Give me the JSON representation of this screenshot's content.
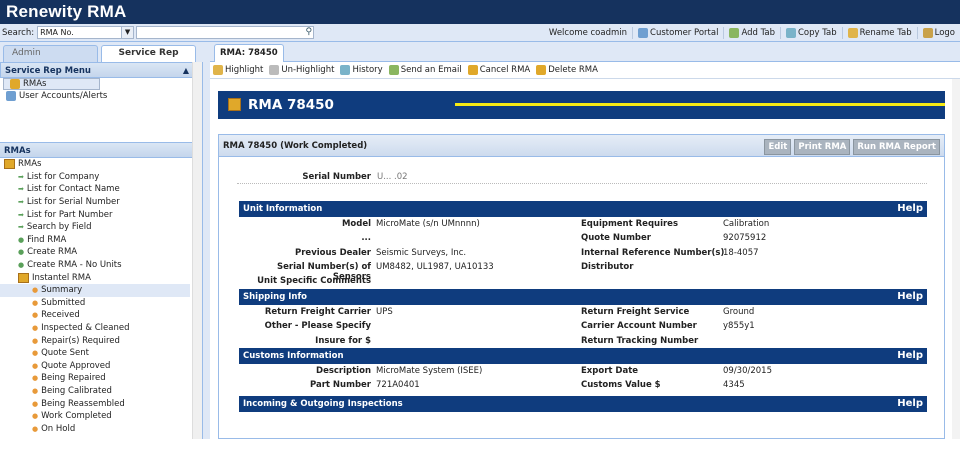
{
  "app": {
    "title": "Renewity RMA"
  },
  "search": {
    "label": "Search:",
    "field_value": "RMA No.",
    "input_value": ""
  },
  "topnav": {
    "welcome": "Welcome coadmin",
    "items": [
      "Customer Portal",
      "Add Tab",
      "Copy Tab",
      "Rename Tab",
      "Logo"
    ]
  },
  "left_tabs": [
    "Admin",
    "Service Rep"
  ],
  "service_menu": {
    "title": "Service Rep Menu",
    "items": [
      "RMAs",
      "User Accounts/Alerts"
    ]
  },
  "rmas_panel": {
    "title": "RMAs",
    "tree": [
      {
        "label": "RMAs",
        "level": 0
      },
      {
        "label": "List for Company",
        "level": 1
      },
      {
        "label": "List for Contact Name",
        "level": 1
      },
      {
        "label": "List for Serial Number",
        "level": 1
      },
      {
        "label": "List for Part Number",
        "level": 1
      },
      {
        "label": "Search by Field",
        "level": 1
      },
      {
        "label": "Find RMA",
        "level": 1
      },
      {
        "label": "Create RMA",
        "level": 1
      },
      {
        "label": "Create RMA - No Units",
        "level": 1
      },
      {
        "label": "Instantel RMA",
        "level": 1
      },
      {
        "label": "Summary",
        "level": 2
      },
      {
        "label": "Submitted",
        "level": 2
      },
      {
        "label": "Received",
        "level": 2
      },
      {
        "label": "Inspected & Cleaned",
        "level": 2
      },
      {
        "label": "Repair(s) Required",
        "level": 2
      },
      {
        "label": "Quote Sent",
        "level": 2
      },
      {
        "label": "Quote Approved",
        "level": 2
      },
      {
        "label": "Being Repaired",
        "level": 2
      },
      {
        "label": "Being Calibrated",
        "level": 2
      },
      {
        "label": "Being Reassembled",
        "level": 2
      },
      {
        "label": "Work Completed",
        "level": 2
      },
      {
        "label": "On Hold",
        "level": 2
      }
    ]
  },
  "main_tab": "RMA: 78450",
  "toolbar": [
    "Highlight",
    "Un-Highlight",
    "History",
    "Send an Email",
    "Cancel RMA",
    "Delete RMA"
  ],
  "banner_title": "RMA 78450",
  "rma_header": {
    "title": "RMA 78450   (Work Completed)",
    "buttons": [
      "Edit",
      "Print RMA",
      "Run RMA Report"
    ]
  },
  "serial": {
    "label": "Serial Number",
    "value": "U... .02"
  },
  "sections": [
    {
      "title": "Unit Information",
      "help": "Help",
      "rows": [
        {
          "k1": "Model",
          "v1": "MicroMate (s/n UMnnnn)",
          "k2": "Equipment Requires",
          "v2": "Calibration"
        },
        {
          "k1": "...",
          "v1": "",
          "k2": "Quote Number",
          "v2": "92075912"
        },
        {
          "k1": "Previous Dealer",
          "v1": "Seismic Surveys, Inc.",
          "k2": "Internal Reference Number(s)",
          "v2": "18-4057"
        },
        {
          "k1": "Serial Number(s) of Sensors",
          "v1": "UM8482, UL1987, UA10133",
          "k2": "Distributor",
          "v2": ""
        },
        {
          "k1": "Unit Specific Comments",
          "v1": "",
          "k2": "",
          "v2": ""
        }
      ]
    },
    {
      "title": "Shipping Info",
      "help": "Help",
      "rows": [
        {
          "k1": "Return Freight Carrier",
          "v1": "UPS",
          "k2": "Return Freight Service",
          "v2": "Ground"
        },
        {
          "k1": "Other - Please Specify",
          "v1": "",
          "k2": "Carrier Account Number",
          "v2": "y855y1"
        },
        {
          "k1": "Insure for $",
          "v1": "",
          "k2": "Return Tracking Number",
          "v2": ""
        }
      ]
    },
    {
      "title": "Customs Information",
      "help": "Help",
      "rows": [
        {
          "k1": "Description",
          "v1": "MicroMate System (ISEE)",
          "k2": "Export Date",
          "v2": "09/30/2015"
        },
        {
          "k1": "Part Number",
          "v1": "721A0401",
          "k2": "Customs Value $",
          "v2": "4345"
        }
      ]
    },
    {
      "title": "Incoming & Outgoing Inspections",
      "help": "Help",
      "rows": []
    }
  ]
}
